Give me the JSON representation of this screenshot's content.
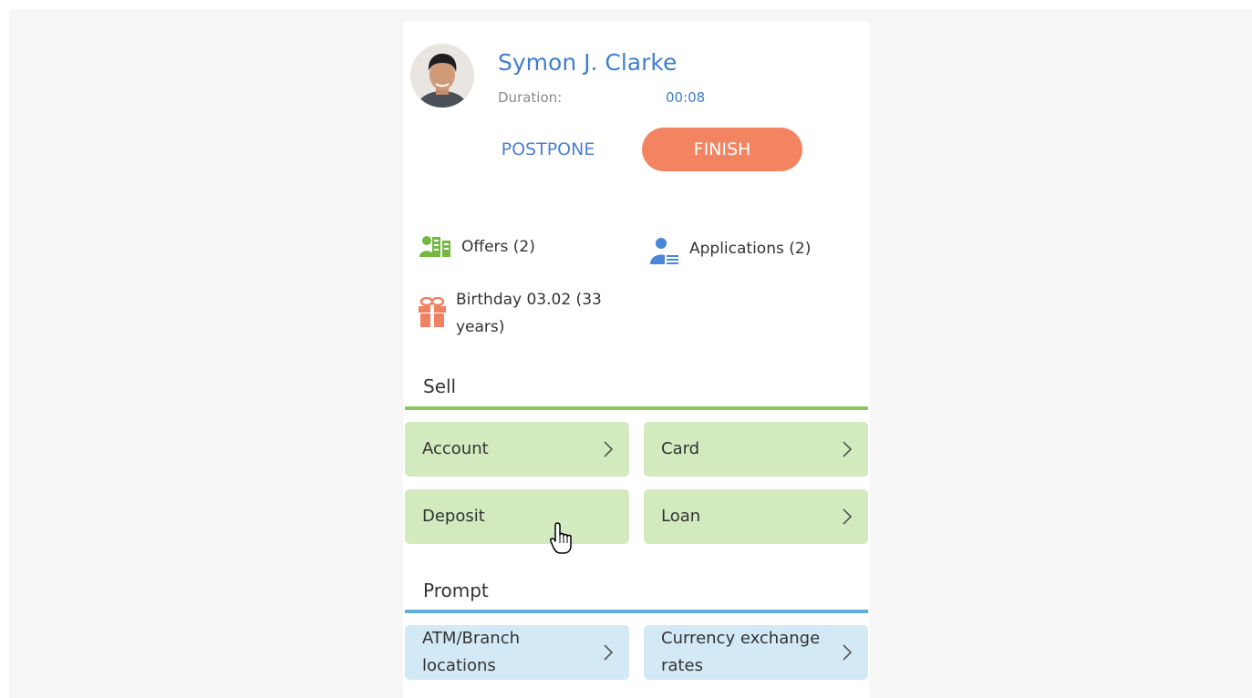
{
  "contact": {
    "name": "Symon J. Clarke",
    "duration_label": "Duration:",
    "duration_value": "00:08",
    "avatar_icon": "person-photo"
  },
  "actions": {
    "postpone_label": "POSTPONE",
    "finish_label": "FINISH"
  },
  "info": {
    "offers": {
      "label": "Offers (2)",
      "icon": "offers-icon"
    },
    "applications": {
      "label": "Applications (2)",
      "icon": "user-document-icon"
    },
    "birthday": {
      "label": "Birthday 03.02 (33 years)",
      "icon": "gift-icon"
    }
  },
  "sell": {
    "title": "Sell",
    "tiles": [
      {
        "label": "Account"
      },
      {
        "label": "Card"
      },
      {
        "label": "Deposit"
      },
      {
        "label": "Loan"
      }
    ]
  },
  "prompt": {
    "title": "Prompt",
    "tiles": [
      {
        "label": "ATM/Branch locations"
      },
      {
        "label": "Currency exchange rates"
      }
    ]
  },
  "colors": {
    "accent_blue": "#3f7fd0",
    "finish_orange": "#f28461",
    "sell_green": "#8dc55e",
    "sell_tile": "#d3eabf",
    "prompt_blue": "#5fafd8",
    "prompt_tile": "#d4e9f6"
  }
}
